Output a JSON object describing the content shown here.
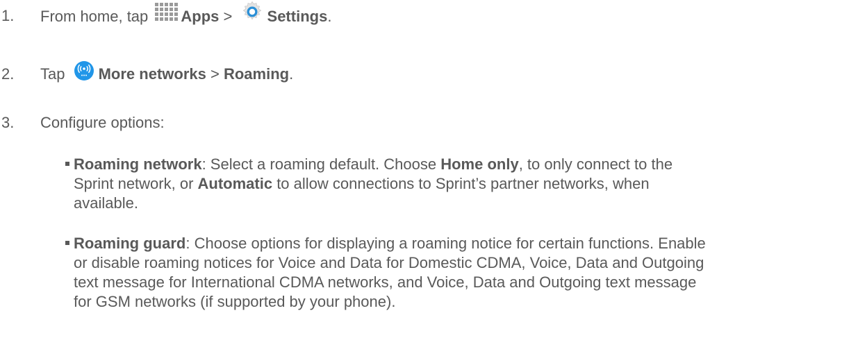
{
  "steps": [
    {
      "number": "1.",
      "prefix": "From home, tap",
      "apps_label": "Apps",
      "separator": ">",
      "settings_label": "Settings",
      "suffix": "."
    },
    {
      "number": "2.",
      "prefix": "Tap",
      "more_networks_label": "More networks",
      "separator": ">",
      "roaming_label": "Roaming",
      "suffix": "."
    },
    {
      "number": "3.",
      "text": "Configure options:"
    }
  ],
  "options": [
    {
      "term": "Roaming network",
      "lines": [
        {
          "a": ": Select a roaming default. Choose ",
          "b": "Home only",
          "c": ", to only connect to the"
        },
        {
          "a": "Sprint network, or ",
          "b": "Automatic",
          "c": " to allow connections to Sprint’s partner networks, when"
        },
        {
          "a": "available."
        }
      ]
    },
    {
      "term": "Roaming guard",
      "lines": [
        {
          "a": ": Choose options for displaying a roaming notice for certain functions. Enable"
        },
        {
          "a": "or disable roaming notices for Voice and Data for Domestic CDMA, Voice, Data and Outgoing"
        },
        {
          "a": "text message for International CDMA networks, and Voice, Data and Outgoing text message"
        },
        {
          "a": "for GSM networks (if supported by your phone)."
        }
      ]
    }
  ],
  "icons": {
    "apps": "apps-grid-icon",
    "settings": "settings-gear-icon",
    "more_networks": "more-networks-icon"
  },
  "colors": {
    "text": "#595959",
    "apps_icon": "#9a9a9a",
    "settings_ring": "#2a8fd6",
    "network_badge": "#2196e8"
  }
}
